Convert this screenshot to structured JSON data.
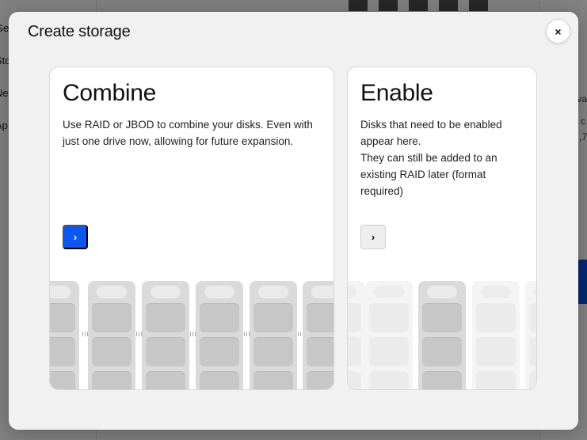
{
  "background": {
    "sidebar_items": [
      "Ge",
      "Sto",
      "Ne",
      "Ap"
    ],
    "right_labels": [
      "va",
      "c",
      ",7"
    ]
  },
  "modal": {
    "title": "Create storage",
    "close_label": "×"
  },
  "cards": {
    "combine": {
      "title": "Combine",
      "description": "Use RAID or JBOD to combine your disks. Even with just one drive now, allowing for future expansion.",
      "button_label": "›"
    },
    "enable": {
      "title": "Enable",
      "description_lines": [
        "Disks that need to be enabled appear here.",
        "They can still be added to an existing RAID later (format required)"
      ],
      "button_label": "›"
    }
  },
  "colors": {
    "primary": "#0b57f0",
    "modal_bg": "#f1f1f1",
    "card_bg": "#ffffff"
  }
}
